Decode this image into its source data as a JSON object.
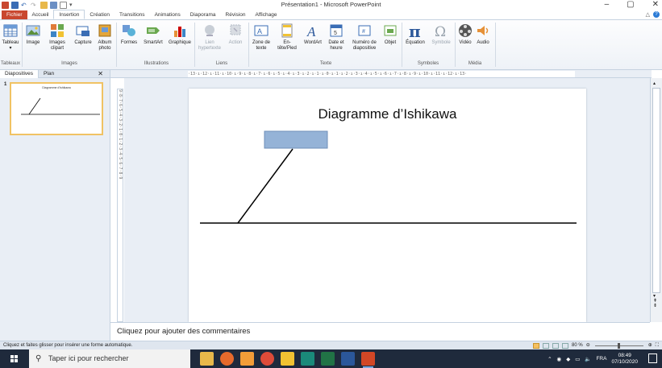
{
  "window": {
    "title": "Présentation1 - Microsoft PowerPoint",
    "controls": {
      "minimize": "–",
      "maximize": "▢",
      "close": "✕"
    }
  },
  "quick_access": [
    "powerpoint-logo",
    "save-icon",
    "undo-icon",
    "redo-icon",
    "open-icon",
    "print-preview-icon",
    "new-icon",
    "customize-icon"
  ],
  "tabs": [
    {
      "label": "Fichier"
    },
    {
      "label": "Accueil"
    },
    {
      "label": "Insertion"
    },
    {
      "label": "Création"
    },
    {
      "label": "Transitions"
    },
    {
      "label": "Animations"
    },
    {
      "label": "Diaporama"
    },
    {
      "label": "Révision"
    },
    {
      "label": "Affichage"
    }
  ],
  "ribbon": {
    "buttons": {
      "tableau": "Tableau",
      "image": "Image",
      "images_clipart": "Images clipart",
      "capture": "Capture",
      "album": "Album photo",
      "formes": "Formes",
      "smartart": "SmartArt",
      "graphique": "Graphique",
      "lien": "Lien hypertexte",
      "action": "Action",
      "zone": "Zone de texte",
      "entete": "En-tête/Pied",
      "wordart": "WordArt",
      "date": "Date et heure",
      "numero": "Numéro de diapositive",
      "objet": "Objet",
      "equation": "Équation",
      "symbole": "Symbole",
      "video": "Vidéo",
      "audio": "Audio"
    },
    "groups": {
      "tableaux": "Tableaux",
      "images": "Images",
      "illustrations": "Illustrations",
      "liens": "Liens",
      "texte": "Texte",
      "symboles": "Symboles",
      "media": "Média"
    }
  },
  "left_panel": {
    "tab_slides": "Diapositives",
    "tab_outline": "Plan",
    "close": "✕",
    "slide_number": "1",
    "thumb_title": "Diagramme d'Ishikawa"
  },
  "ruler": {
    "horizontal": "·13·ı·12·ı·11·ı·10·ı·9·ı·8·ı·7·ı·6·ı·5·ı·4·ı·3·ı·2·ı·1·ı·0·ı·1·ı·2·ı·3·ı·4·ı·5·ı·6·ı·7·ı·8·ı·9·ı·10·ı·11·ı·12·ı·13·",
    "vertical": "9·8·7·6·5·4·3·2·1·0·1·2·3·4·5·6·7·8·9"
  },
  "slide": {
    "title": "Diagramme d’Ishikawa",
    "box_color": "#95b3d7",
    "box_border": "#6f8fb8"
  },
  "notes": {
    "placeholder": "Cliquez pour ajouter des commentaires"
  },
  "status": {
    "text": "Cliquez et faites glisser pour insérer une forme automatique.",
    "zoom": "80 %",
    "zoom_fraction": 0.5
  },
  "taskbar": {
    "search_placeholder": "Taper ici pour rechercher",
    "lang": "FRA",
    "time": "08:49",
    "date": "07/10/2020"
  },
  "colors": {
    "file_tab": "#c9472f",
    "accent": "#2b579a",
    "taskbar": "#1f2a3c"
  }
}
